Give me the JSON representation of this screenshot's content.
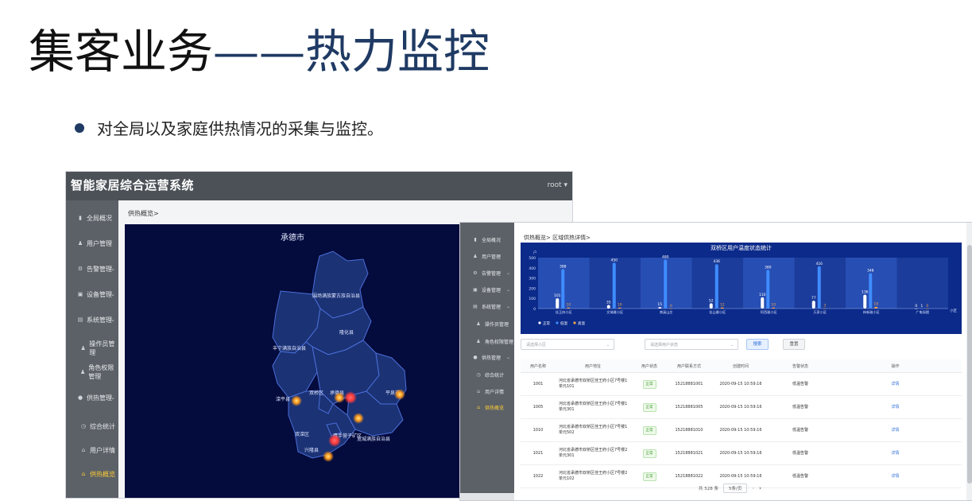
{
  "slide": {
    "title_part1": "集客业务",
    "title_part2": "——热力监控",
    "bullet": "对全局以及家庭供热情况的采集与监控。",
    "accent_color": "#1f3a63"
  },
  "screenshot1": {
    "app_title": "智能家居综合运营系统",
    "user": "root ▾",
    "breadcrumb": "供热概览>",
    "sidebar": [
      {
        "label": "全局概况",
        "icon": "bar-chart-icon",
        "arrow": ""
      },
      {
        "label": "用户管理",
        "icon": "user-icon",
        "arrow": ""
      },
      {
        "label": "告警管理",
        "icon": "gear-icon",
        "arrow": "⌄"
      },
      {
        "label": "设备管理",
        "icon": "device-icon",
        "arrow": "⌄"
      },
      {
        "label": "系统管理",
        "icon": "document-icon",
        "arrow": "⌄"
      },
      {
        "label": "操作员管理",
        "icon": "user-icon",
        "arrow": "",
        "sub": true
      },
      {
        "label": "角色权限管理",
        "icon": "user-icon",
        "arrow": "",
        "sub": true
      },
      {
        "label": "供热管理",
        "icon": "location-pin-icon",
        "arrow": "⌄"
      },
      {
        "label": "综合统计",
        "icon": "clock-icon",
        "arrow": "",
        "sub": true
      },
      {
        "label": "用户详情",
        "icon": "home-icon",
        "arrow": "",
        "sub": true
      },
      {
        "label": "供热概览",
        "icon": "home-icon",
        "arrow": "",
        "sub": true,
        "active": true
      }
    ],
    "map": {
      "title": "承德市",
      "regions": [
        "围场满族蒙古族自治县",
        "丰宁满族自治县",
        "隆化县",
        "滦平县",
        "双桥区",
        "承德县",
        "平泉市",
        "双滦区",
        "鹰手营子矿区",
        "宽城满族自治县",
        "兴隆县"
      ],
      "hotspot_color": "#ff9a1a",
      "alert_color": "#ff3b3b"
    }
  },
  "screenshot2": {
    "breadcrumb": "供热概览>   区域供热详情>",
    "sidebar": [
      {
        "label": "全局概况",
        "icon": "bar-chart-icon",
        "arrow": ""
      },
      {
        "label": "用户管理",
        "icon": "user-icon",
        "arrow": ""
      },
      {
        "label": "告警管理",
        "icon": "gear-icon",
        "arrow": "⌄"
      },
      {
        "label": "设备管理",
        "icon": "device-icon",
        "arrow": "⌄"
      },
      {
        "label": "系统管理",
        "icon": "document-icon",
        "arrow": "⌄"
      },
      {
        "label": "操作员管理",
        "icon": "user-icon",
        "arrow": "",
        "sub": true
      },
      {
        "label": "角色权限管理",
        "icon": "user-icon",
        "arrow": "",
        "sub": true
      },
      {
        "label": "供热管理",
        "icon": "location-pin-icon",
        "arrow": "⌄"
      },
      {
        "label": "综合统计",
        "icon": "clock-icon",
        "arrow": "",
        "sub": true
      },
      {
        "label": "用户详情",
        "icon": "home-icon",
        "arrow": "",
        "sub": true
      },
      {
        "label": "供热概览",
        "icon": "home-icon",
        "arrow": "",
        "sub": true,
        "active": true
      }
    ],
    "chart_data": {
      "type": "bar",
      "title": "双桥区用户温度状态统计",
      "ylabel": "户",
      "xlabel": "小区",
      "ylim": [
        0,
        500
      ],
      "yticks": [
        0,
        100,
        200,
        300,
        400,
        500
      ],
      "categories": [
        "佳王府小区",
        "文城雅小区",
        "南溪山庄",
        "佳山雅小区",
        "阿西雅小区",
        "万泉小区",
        "林新雅小区",
        "广电局楼"
      ],
      "series": [
        {
          "name": "正常",
          "color": "#ffffff",
          "values": [
            101,
            35,
            15,
            52,
            110,
            77,
            136,
            0
          ]
        },
        {
          "name": "低温",
          "color": "#3f8cff",
          "values": [
            388,
            450,
            480,
            436,
            380,
            416,
            348,
            1
          ]
        },
        {
          "name": "高温",
          "color": "#f0a24a",
          "values": [
            10,
            10,
            0,
            12,
            10,
            3,
            18,
            0
          ]
        }
      ]
    },
    "filters": {
      "community_placeholder": "请选择小区",
      "state_placeholder": "请选择用户状态",
      "search_label": "搜索",
      "reset_label": "重置"
    },
    "table": {
      "headers": [
        "用户名称",
        "用户地址",
        "用户状态",
        "用户联系方式",
        "创建时间",
        "告警状态",
        "操作"
      ],
      "rows": [
        {
          "name": "1001",
          "addr": "河北省承德市双桥区佳王府小区7号楼1单元101",
          "status": "正常",
          "phone": "15218881001",
          "created": "2020-09-15 10:59:16",
          "alarm": "低温告警",
          "op": "详情"
        },
        {
          "name": "1005",
          "addr": "河北省承德市双桥区佳王府小区7号楼1单元301",
          "status": "正常",
          "phone": "15218881005",
          "created": "2020-09-15 10:59:16",
          "alarm": "低温告警",
          "op": "详情"
        },
        {
          "name": "1010",
          "addr": "河北省承德市双桥区佳王府小区7号楼1单元502",
          "status": "正常",
          "phone": "15218881010",
          "created": "2020-09-15 10:59:16",
          "alarm": "低温告警",
          "op": "详情"
        },
        {
          "name": "1021",
          "addr": "河北省承德市双桥区佳王府小区7号楼2单元301",
          "status": "正常",
          "phone": "15218881021",
          "created": "2020-09-15 10:59:16",
          "alarm": "低温告警",
          "op": "详情"
        },
        {
          "name": "1022",
          "addr": "河北省承德市双桥区佳王府小区7号楼2单元102",
          "status": "正常",
          "phone": "15218881022",
          "created": "2020-09-15 10:59:16",
          "alarm": "低温告警",
          "op": "详情"
        }
      ]
    },
    "pager": {
      "total": "共 528 条",
      "page_size": "5条/页",
      "prev": "‹",
      "next": "›"
    }
  }
}
